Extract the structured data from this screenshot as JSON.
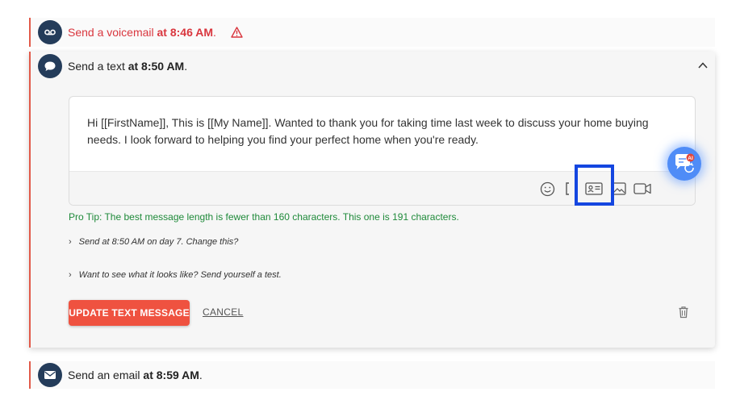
{
  "voicemail_step": {
    "label": "Send a voicemail",
    "time": "at 8:46 AM",
    "suffix": ".",
    "icon": "voicemail-icon",
    "status_icon": "warning-icon",
    "status_color": "#d9363e"
  },
  "text_step": {
    "label": "Send a text",
    "time": "at 8:50 AM",
    "suffix": ".",
    "icon": "chat-bubble-icon",
    "message": "Hi [[FirstName]], This is [[My Name]]. Wanted to thank you for taking time last week to discuss your home buying needs. I look forward to helping you find your perfect home when you're ready.",
    "toolbar_icons": [
      "emoji-icon",
      "merge-field-icon",
      "contact-card-icon",
      "image-icon",
      "video-icon"
    ],
    "ai_button_badge": "AI",
    "pro_tip": "Pro Tip: The best message length is fewer than 160 characters. This one is 191 characters.",
    "schedule_expander": "Send at 8:50 AM on day 7. Change this?",
    "test_expander": "Want to see what it looks like? Send yourself a test.",
    "update_button": "UPDATE TEXT MESSAGE",
    "cancel_link": "CANCEL",
    "accent_color": "#ef5240",
    "tip_color": "#1f8a3a"
  },
  "email_step": {
    "label": "Send an email",
    "time": "at 8:59 AM",
    "suffix": ".",
    "icon": "envelope-icon"
  }
}
